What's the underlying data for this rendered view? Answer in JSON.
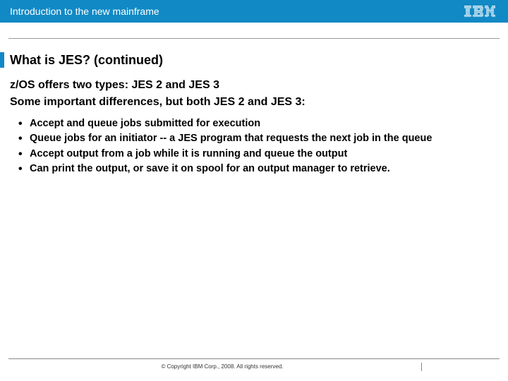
{
  "header": {
    "title": "Introduction to the new mainframe",
    "logo_alt": "IBM"
  },
  "slide": {
    "title": "What is JES? (continued)",
    "intro_lines": [
      "z/OS offers two types: JES 2 and JES 3",
      "Some important differences, but both JES 2 and JES 3:"
    ],
    "bullets": [
      "Accept and queue jobs submitted for execution",
      "Queue jobs for an initiator -- a JES program that requests the next job in the queue",
      "Accept output from a job while it is running and queue the output",
      "Can print the output, or save it on spool for an output manager to retrieve."
    ]
  },
  "footer": {
    "copyright": "© Copyright IBM Corp., 2008. All rights reserved."
  }
}
